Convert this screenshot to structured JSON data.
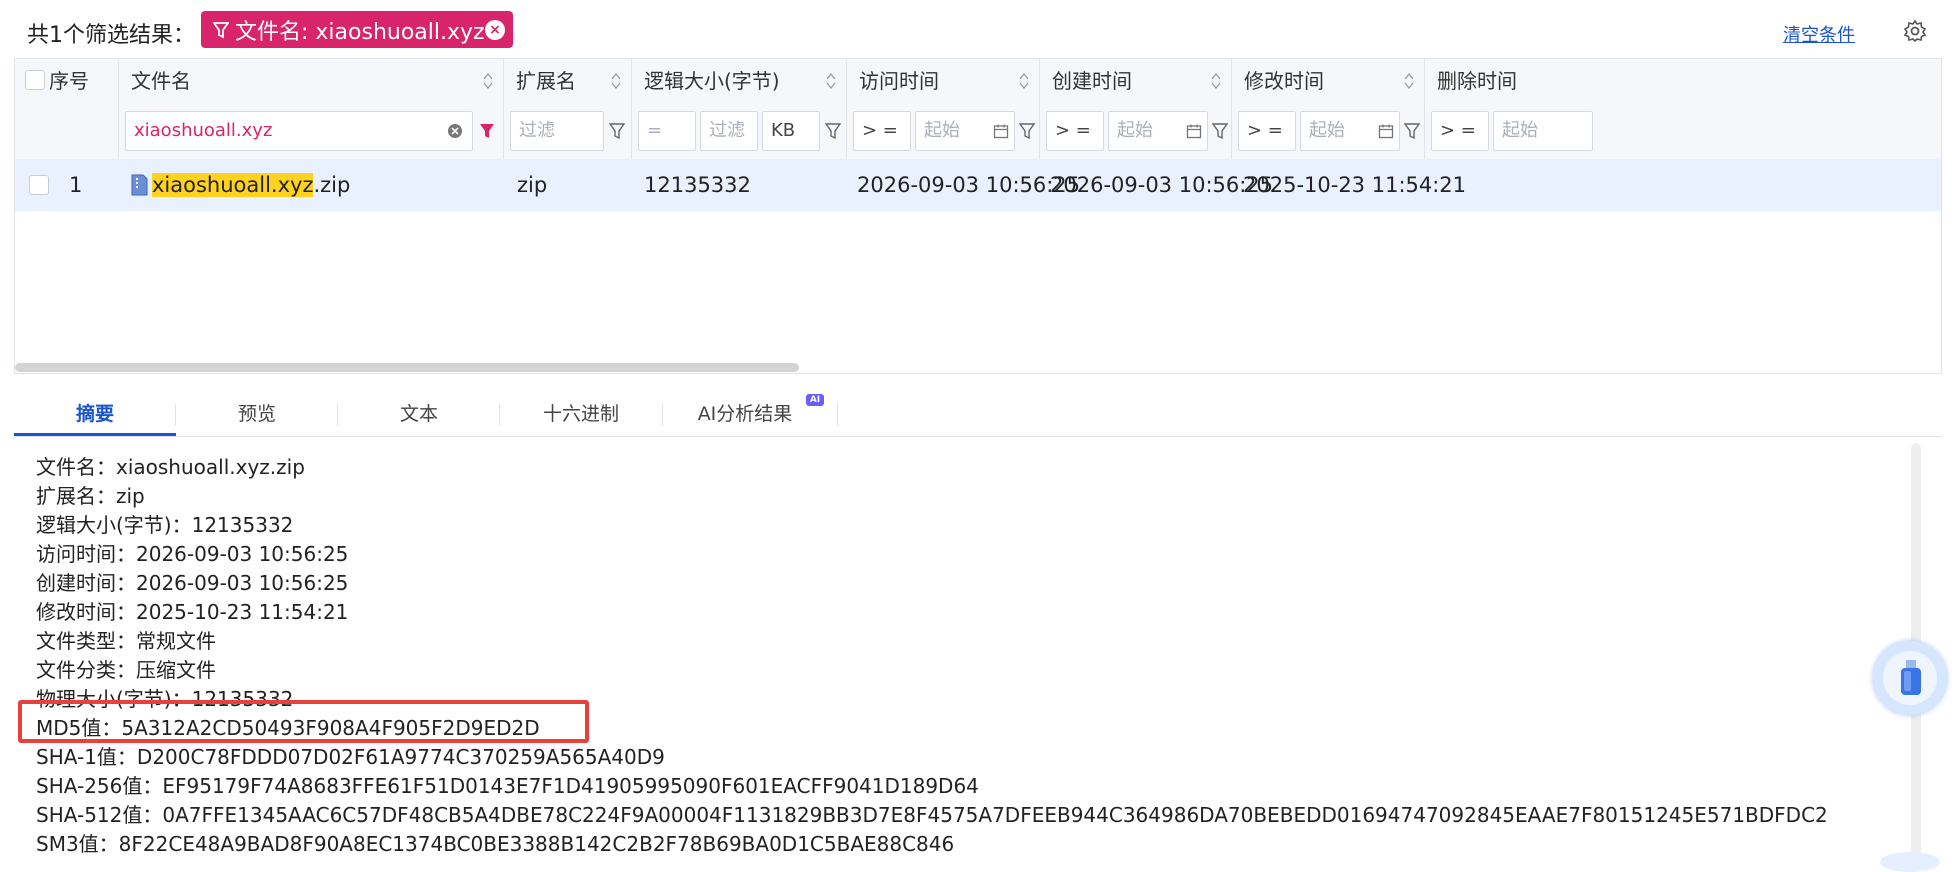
{
  "topbar": {
    "result_count": "共1个筛选结果：",
    "filter_tag": "文件名: xiaoshuoall.xyz",
    "clear_link": "清空条件"
  },
  "columns": [
    {
      "label": "序号"
    },
    {
      "label": "文件名"
    },
    {
      "label": "扩展名"
    },
    {
      "label": "逻辑大小(字节)"
    },
    {
      "label": "访问时间"
    },
    {
      "label": "创建时间"
    },
    {
      "label": "修改时间"
    },
    {
      "label": "删除时间"
    }
  ],
  "filters": {
    "filename_value": "xiaoshuoall.xyz",
    "ext_placeholder": "过滤",
    "size_op": "=",
    "size_placeholder": "过滤",
    "size_unit": "KB",
    "access_op": "> =",
    "access_placeholder": "起始",
    "create_op": "> =",
    "create_placeholder": "起始",
    "modify_op": "> =",
    "modify_placeholder": "起始",
    "delete_op": "> =",
    "delete_placeholder": "起始"
  },
  "rows": [
    {
      "index": "1",
      "name_highlight": "xiaoshuoall.xyz",
      "name_rest": ".zip",
      "ext": "zip",
      "size": "12135332",
      "access": "2026-09-03 10:56:25",
      "create": "2026-09-03 10:56:25",
      "modify": "2025-10-23 11:54:21"
    }
  ],
  "tabs": [
    {
      "label": "摘要"
    },
    {
      "label": "预览"
    },
    {
      "label": "文本"
    },
    {
      "label": "十六进制"
    },
    {
      "label": "AI分析结果"
    }
  ],
  "ai_badge": "AI",
  "summary": [
    "文件名：xiaoshuoall.xyz.zip",
    "扩展名：zip",
    "逻辑大小(字节)：12135332",
    "访问时间：2026-09-03 10:56:25",
    "创建时间：2026-09-03 10:56:25",
    "修改时间：2025-10-23 11:54:21",
    "文件类型：常规文件",
    "文件分类：压缩文件",
    "物理大小(字节)：12135332",
    "MD5值：5A312A2CD50493F908A4F905F2D9ED2D",
    "SHA-1值：D200C78FDDD07D02F61A9774C370259A565A40D9",
    "SHA-256值：EF95179F74A8683FFE61F51D0143E7F1D41905995090F601EACFF9041D189D64",
    "SHA-512值：0A7FFE1345AAC6C57DF48CB5A4DBE78C224F9A00004F1131829BB3D7E8F4575A7DFEEB944C364986DA70BEBEDD01694747092845EAAE7F80151245E571BDFDC2",
    "SM3值：8F22CE48A9BAD8F90A8EC1374BC0BE3388B142C2B2F78B69BA0D1C5BAE88C846"
  ]
}
